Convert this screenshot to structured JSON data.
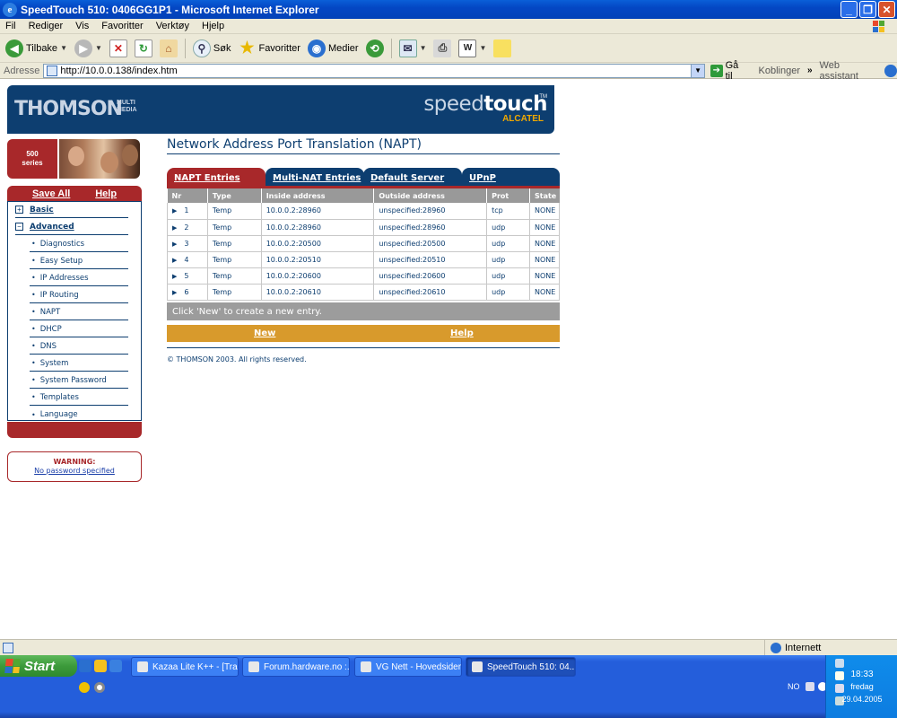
{
  "window": {
    "title": "SpeedTouch 510:  0406GG1P1 - Microsoft Internet Explorer"
  },
  "menu": [
    "Fil",
    "Rediger",
    "Vis",
    "Favoritter",
    "Verktøy",
    "Hjelp"
  ],
  "toolbar": {
    "back": "Tilbake",
    "search": "Søk",
    "favorites": "Favoritter",
    "media": "Medier"
  },
  "address": {
    "label": "Adresse",
    "url": "http://10.0.0.138/index.htm",
    "go": "Gå til",
    "links": "Koblinger",
    "chevron": "»",
    "assistant": "Web assistant"
  },
  "banner": {
    "thomson": "THOMSON",
    "multimedia_1": "MULTI",
    "multimedia_2": "MEDIA",
    "speed_a": "speed",
    "speed_b": "touch",
    "tm": "TM",
    "alcatel": "ALCATEL"
  },
  "sidebar": {
    "series_num": "500",
    "series_label": "series",
    "save_all": "Save All",
    "help": "Help",
    "basic": "Basic",
    "advanced": "Advanced",
    "basic_toggle": "+",
    "advanced_toggle": "−",
    "items": [
      "Diagnostics",
      "Easy Setup",
      "IP Addresses",
      "IP Routing",
      "NAPT",
      "DHCP",
      "DNS",
      "System",
      "System Password",
      "Templates",
      "Language"
    ]
  },
  "warning": {
    "title": "WARNING:",
    "text": "No password specified"
  },
  "page": {
    "title": "Network Address Port Translation (NAPT)",
    "tabs": [
      "NAPT Entries",
      "Multi-NAT Entries",
      "Default Server",
      "UPnP"
    ],
    "columns": [
      "Nr",
      "Type",
      "Inside address",
      "Outside address",
      "Prot",
      "State"
    ],
    "rows": [
      [
        "1",
        "Temp",
        "10.0.0.2:28960",
        "unspecified:28960",
        "tcp",
        "NONE"
      ],
      [
        "2",
        "Temp",
        "10.0.0.2:28960",
        "unspecified:28960",
        "udp",
        "NONE"
      ],
      [
        "3",
        "Temp",
        "10.0.0.2:20500",
        "unspecified:20500",
        "udp",
        "NONE"
      ],
      [
        "4",
        "Temp",
        "10.0.0.2:20510",
        "unspecified:20510",
        "udp",
        "NONE"
      ],
      [
        "5",
        "Temp",
        "10.0.0.2:20600",
        "unspecified:20600",
        "udp",
        "NONE"
      ],
      [
        "6",
        "Temp",
        "10.0.0.2:20610",
        "unspecified:20610",
        "udp",
        "NONE"
      ]
    ],
    "info": "Click 'New' to create a new entry.",
    "new": "New",
    "help": "Help",
    "copyright": "© THOMSON 2003. All rights reserved."
  },
  "status": {
    "zone": "Internett"
  },
  "taskbar": {
    "start": "Start",
    "tasks": [
      "Kazaa Lite K++ - [Tra...",
      "Forum.hardware.no :...",
      "VG Nett - Hovedsiden...",
      "SpeedTouch 510:  04..."
    ],
    "lang": "NO",
    "time": "18:33",
    "day": "fredag",
    "date": "29.04.2005"
  }
}
